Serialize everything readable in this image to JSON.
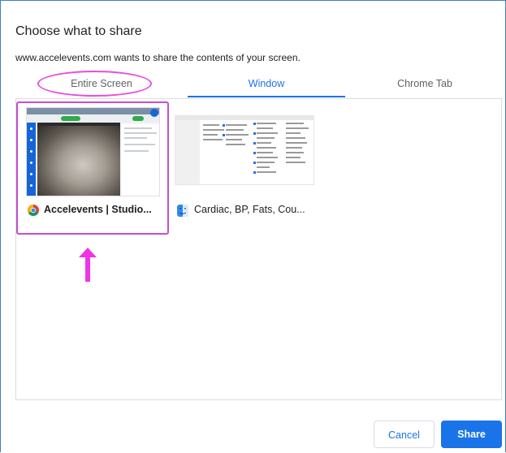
{
  "dialog": {
    "title": "Choose what to share",
    "subtitle": "www.accelevents.com wants to share the contents of your screen."
  },
  "tabs": [
    {
      "label": "Entire Screen",
      "selected": false
    },
    {
      "label": "Window",
      "selected": true
    },
    {
      "label": "Chrome Tab",
      "selected": false
    }
  ],
  "sources": [
    {
      "label": "Accelevents | Studio...",
      "icon": "chrome-icon",
      "highlighted": true
    },
    {
      "label": "Cardiac, BP, Fats, Cou...",
      "icon": "finder-icon",
      "highlighted": false
    }
  ],
  "buttons": {
    "cancel": "Cancel",
    "share": "Share"
  },
  "colors": {
    "accent": "#1a73e8",
    "annotation": "#e64fe0",
    "frame": "#3f7fc4"
  }
}
